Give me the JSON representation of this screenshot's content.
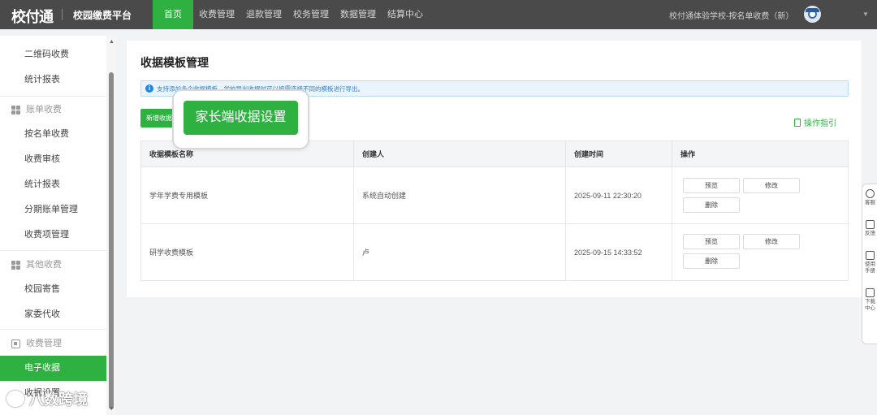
{
  "topbar": {
    "logo": "校付通",
    "platform": "校园缴费平台",
    "nav": [
      {
        "label": "首页",
        "active": true
      },
      {
        "label": "收费管理"
      },
      {
        "label": "退款管理"
      },
      {
        "label": "校务管理"
      },
      {
        "label": "数据管理"
      },
      {
        "label": "结算中心"
      }
    ],
    "school": "校付通体验学校-按名单收费（新）"
  },
  "sidebar": {
    "items": [
      {
        "label": "二维码收费"
      },
      {
        "label": "统计报表"
      },
      {
        "group": "账单收费"
      },
      {
        "label": "按名单收费"
      },
      {
        "label": "收费审核"
      },
      {
        "label": "统计报表"
      },
      {
        "label": "分期账单管理"
      },
      {
        "label": "收费项管理"
      },
      {
        "group": "其他收费"
      },
      {
        "label": "校园寄售"
      },
      {
        "label": "家委代收"
      },
      {
        "group": "收费管理"
      },
      {
        "label": "电子收据",
        "active": true
      },
      {
        "label": "收据设置"
      }
    ]
  },
  "main": {
    "title": "收据模板管理",
    "info": "支持添加多个收据模板，学校导出收据时可以按需选择不同的模板进行导出。",
    "add_button": "新增收据模板",
    "guide": "操作指引",
    "popover_button": "家长端收据设置",
    "table": {
      "headers": [
        "收据模板名称",
        "创建人",
        "创建时间",
        "操作"
      ],
      "rows": [
        {
          "name": "学年学费专用模板",
          "creator": "系统自动创建",
          "time": "2025-09-11 22:30:20"
        },
        {
          "name": "研学收费模板",
          "creator": "卢",
          "time": "2025-09-15 14:33:52"
        }
      ],
      "actions": {
        "preview": "预览",
        "edit": "修改",
        "delete": "删除"
      }
    }
  },
  "float_bar": [
    {
      "label": "客服",
      "icon": "headset-icon"
    },
    {
      "label": "反馈",
      "icon": "feedback-icon"
    },
    {
      "label": "使用手册",
      "icon": "manual-icon"
    },
    {
      "label": "下载中心",
      "icon": "download-icon"
    }
  ],
  "watermark": "八数跨境",
  "colors": {
    "accent": "#2fb142",
    "topbar": "#4a4a4a",
    "info": "#1e88e5"
  }
}
